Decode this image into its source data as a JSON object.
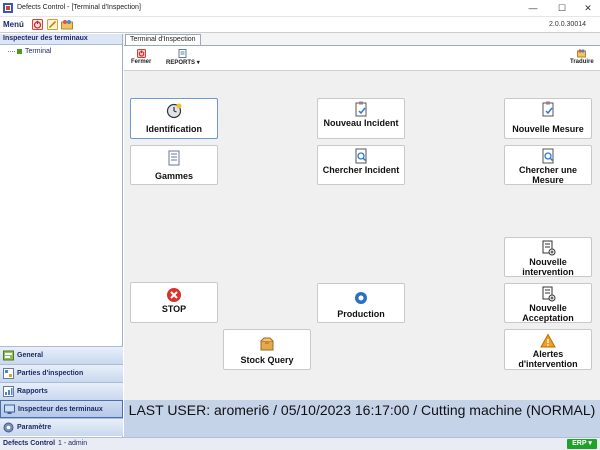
{
  "window": {
    "title": "Defects Control - [Terminal d'Inspection]",
    "minimize_glyph": "—",
    "maximize_glyph": "☐",
    "close_glyph": "✕"
  },
  "menubar": {
    "menu_label": "Menú",
    "version": "2.0.0.30014"
  },
  "left_panel": {
    "header": "Inspecteur des terminaux",
    "tree_item": "Terminal",
    "nav_items": [
      {
        "label": "General",
        "icon": "general-icon"
      },
      {
        "label": "Parties d'inspection",
        "icon": "inspection-parts-icon"
      },
      {
        "label": "Rapports",
        "icon": "reports-icon"
      },
      {
        "label": "Inspecteur des terminaux",
        "icon": "terminal-inspector-icon",
        "active": true
      },
      {
        "label": "Paramètre",
        "icon": "settings-icon"
      }
    ]
  },
  "tab": {
    "label": "Terminal d'Inspection"
  },
  "toolbar": {
    "close_label": "Fermer",
    "reports_label": "REPORTS",
    "reports_caret": "▾",
    "translate_label": "Traduire"
  },
  "tiles": {
    "identification": "Identification",
    "gammes": "Gammes",
    "nouveau_incident": "Nouveau Incident",
    "chercher_incident": "Chercher Incident",
    "nouvelle_mesure": "Nouvelle Mesure",
    "chercher_mesure": "Chercher une Mesure",
    "nouvelle_intervention": "Nouvelle intervention",
    "stop": "STOP",
    "production": "Production",
    "nouvelle_acceptation": "Nouvelle Acceptation",
    "stock_query": "Stock Query",
    "alertes_intervention": "Alertes d'intervention"
  },
  "status": {
    "last_user": "LAST USER: aromeri6 / 05/10/2023 16:17:00 / Cutting machine (NORMAL)"
  },
  "bottombar": {
    "app": "Defects Control",
    "user": "1 - admin",
    "erp": "ERP ▾"
  },
  "colors": {
    "accent": "#1d2a6b",
    "status_bg": "#c5d3e8",
    "erp_green": "#1fa12a",
    "stop_red": "#d8322c"
  }
}
